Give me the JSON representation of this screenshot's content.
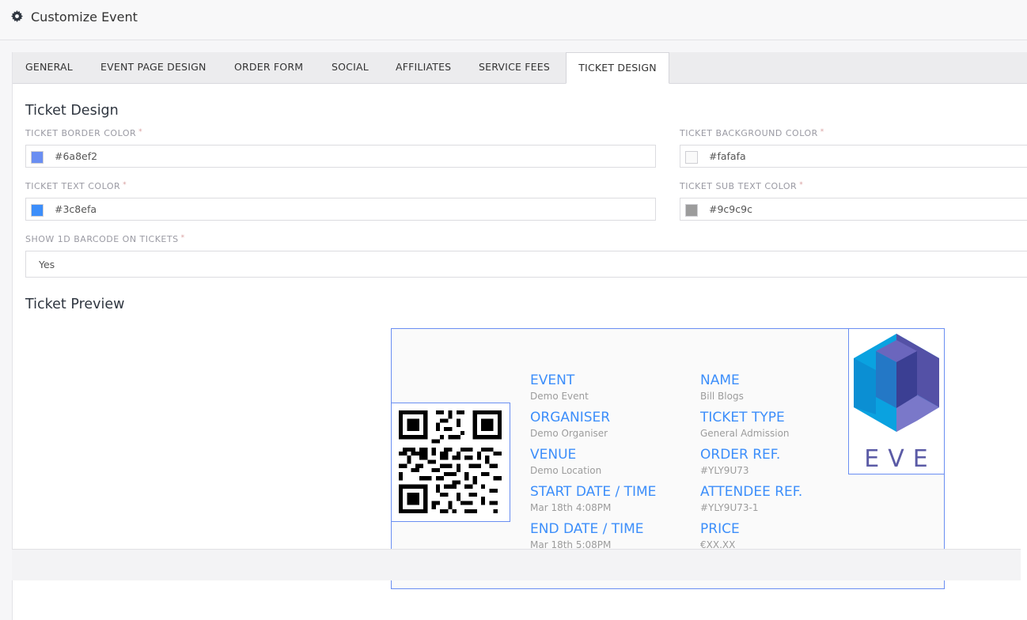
{
  "header": {
    "title": "Customize Event",
    "icon": "gear-icon"
  },
  "tabs": [
    {
      "label": "GENERAL"
    },
    {
      "label": "EVENT PAGE DESIGN"
    },
    {
      "label": "ORDER FORM"
    },
    {
      "label": "SOCIAL"
    },
    {
      "label": "AFFILIATES"
    },
    {
      "label": "SERVICE FEES"
    },
    {
      "label": "TICKET DESIGN",
      "active": true
    }
  ],
  "design": {
    "title": "Ticket Design",
    "border_color": {
      "label": "TICKET BORDER COLOR",
      "value": "#6a8ef2"
    },
    "background_color": {
      "label": "TICKET BACKGROUND COLOR",
      "value": "#fafafa"
    },
    "text_color": {
      "label": "TICKET TEXT COLOR",
      "value": "#3c8efa"
    },
    "sub_text_color": {
      "label": "TICKET SUB TEXT COLOR",
      "value": "#9c9c9c"
    },
    "barcode": {
      "label": "SHOW 1D BARCODE ON TICKETS",
      "value": "Yes"
    },
    "required_mark": "*"
  },
  "preview": {
    "title": "Ticket Preview",
    "logo_text": "EVE",
    "fields_left": [
      {
        "label": "EVENT",
        "value": "Demo Event"
      },
      {
        "label": "ORGANISER",
        "value": "Demo Organiser"
      },
      {
        "label": "VENUE",
        "value": "Demo Location"
      },
      {
        "label": "START DATE / TIME",
        "value": "Mar 18th 4:08PM"
      },
      {
        "label": "END DATE / TIME",
        "value": "Mar 18th 5:08PM"
      }
    ],
    "fields_right": [
      {
        "label": "NAME",
        "value": "Bill Blogs"
      },
      {
        "label": "TICKET TYPE",
        "value": "General Admission"
      },
      {
        "label": "ORDER REF.",
        "value": "#YLY9U73"
      },
      {
        "label": "ATTENDEE REF.",
        "value": "#YLY9U73-1"
      },
      {
        "label": "PRICE",
        "value": "€XX.XX"
      }
    ]
  }
}
